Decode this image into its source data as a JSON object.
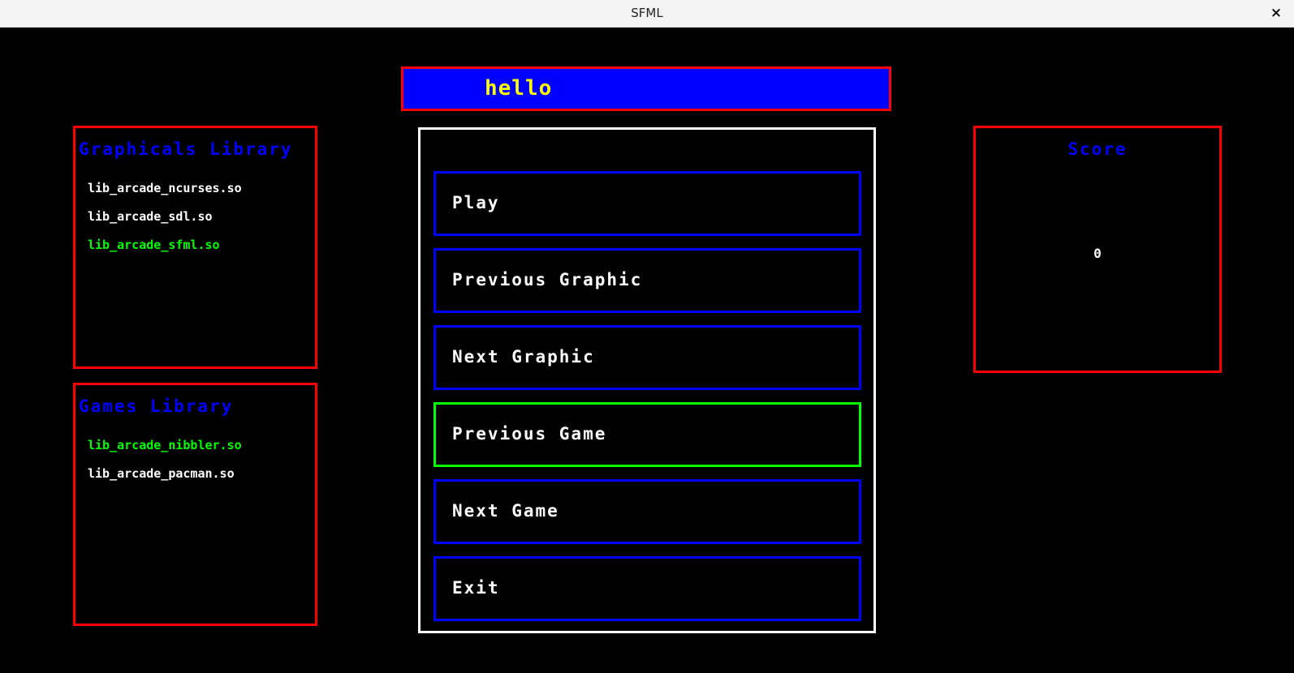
{
  "window": {
    "title": "SFML",
    "close_icon": "×"
  },
  "name_box": {
    "text": "hello"
  },
  "graphics_panel": {
    "title": "Graphicals Library",
    "items": [
      {
        "label": "lib_arcade_ncurses.so",
        "active": false
      },
      {
        "label": "lib_arcade_sdl.so",
        "active": false
      },
      {
        "label": "lib_arcade_sfml.so",
        "active": true
      }
    ]
  },
  "games_panel": {
    "title": "Games Library",
    "items": [
      {
        "label": "lib_arcade_nibbler.so",
        "active": true
      },
      {
        "label": "lib_arcade_pacman.so",
        "active": false
      }
    ]
  },
  "menu": {
    "buttons": [
      {
        "label": "Play",
        "selected": false
      },
      {
        "label": "Previous Graphic",
        "selected": false
      },
      {
        "label": "Next Graphic",
        "selected": false
      },
      {
        "label": "Previous Game",
        "selected": true
      },
      {
        "label": "Next Game",
        "selected": false
      },
      {
        "label": "Exit",
        "selected": false
      }
    ]
  },
  "score_panel": {
    "title": "Score",
    "value": "0"
  },
  "colors": {
    "background": "#000000",
    "panel_border": "#ff0000",
    "panel_title": "#0000ff",
    "button_border": "#0000ff",
    "selected_border": "#00ff00",
    "active_item": "#00ff00",
    "name_text": "#ffff00",
    "name_background": "#0000ff"
  }
}
